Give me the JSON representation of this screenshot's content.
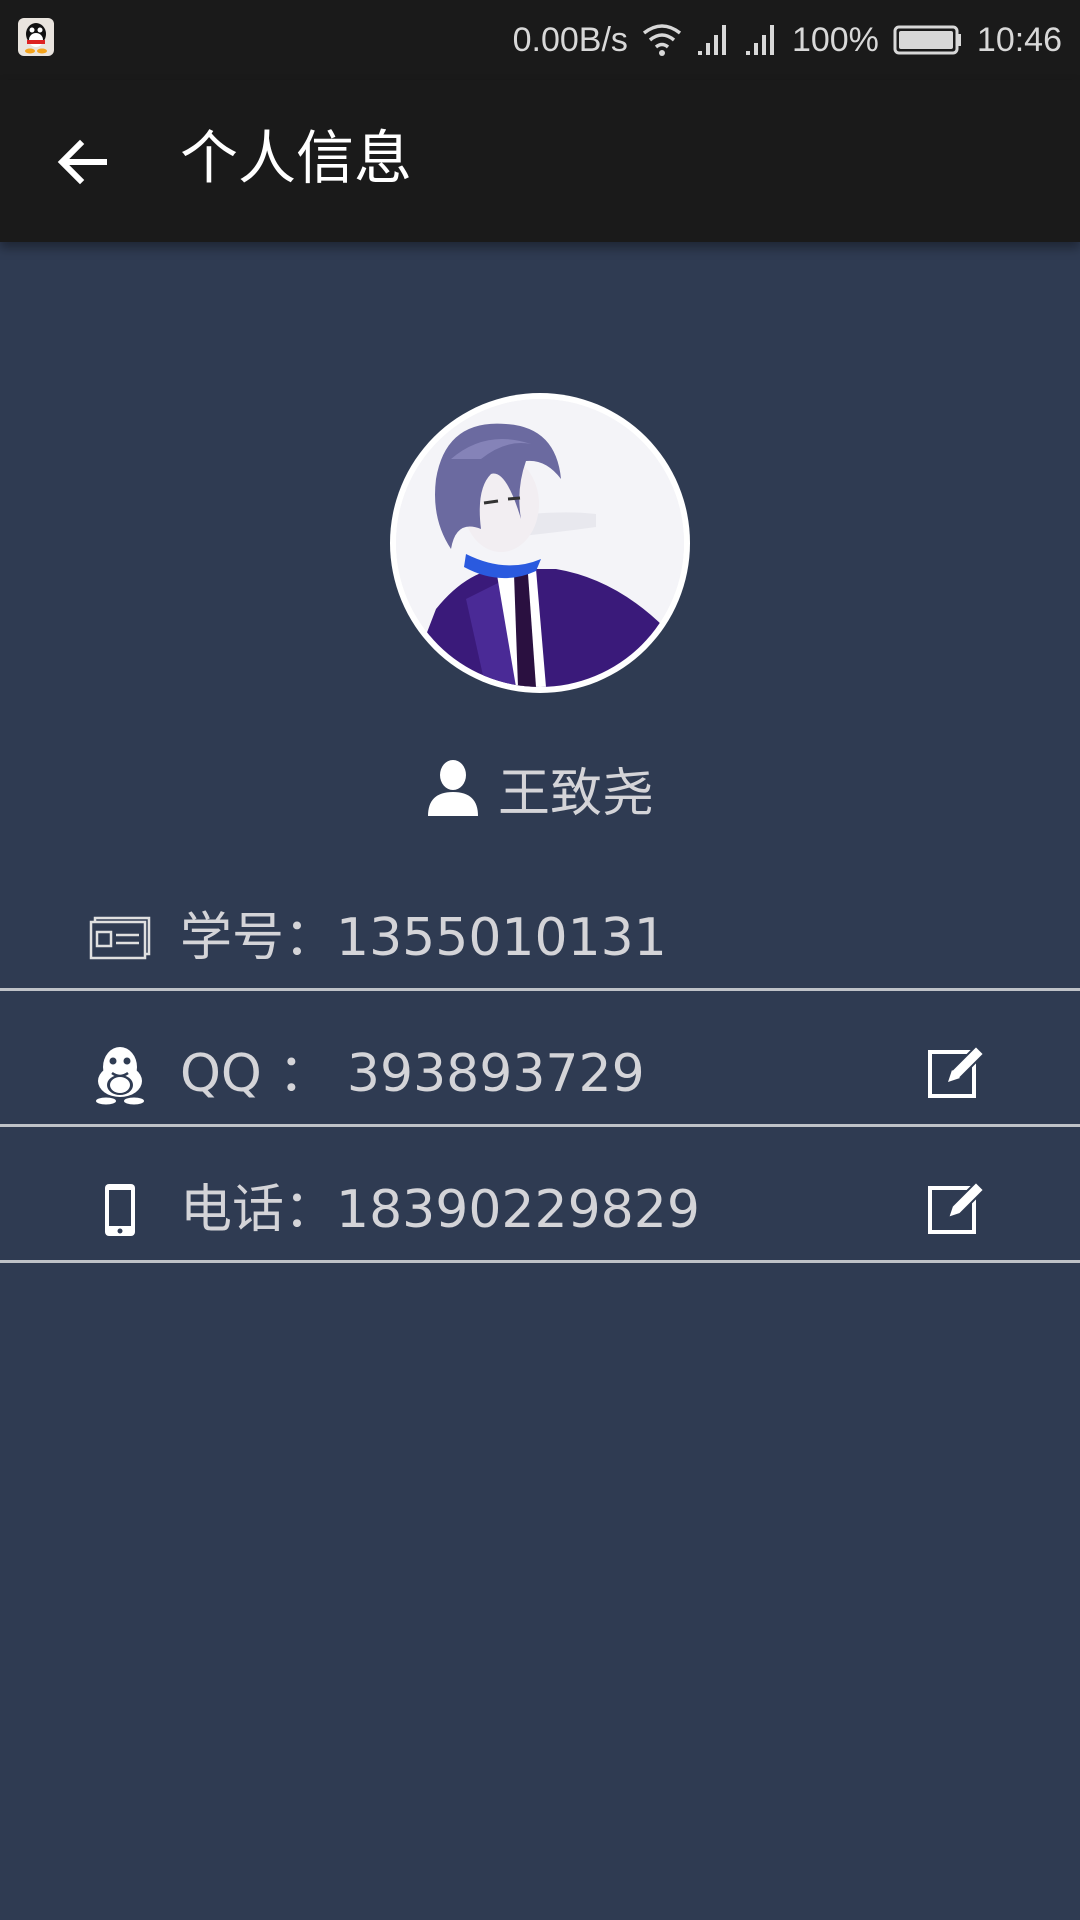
{
  "status_bar": {
    "app_icon": "qq-penguin-icon",
    "net_speed": "0.00B/s",
    "battery": "100%",
    "time": "10:46"
  },
  "app_bar": {
    "back_icon": "arrow-left-icon",
    "title": "个人信息"
  },
  "profile": {
    "avatar": "anime-avatar-image",
    "name_icon": "user-icon",
    "name": "王致尧"
  },
  "info": {
    "student_id": {
      "icon": "id-card-icon",
      "label": "学号：1355010131",
      "editable": false
    },
    "qq": {
      "icon": "qq-penguin-icon",
      "label": "QQ ： 393893729",
      "editable": true
    },
    "phone": {
      "icon": "phone-icon",
      "label": "电话：18390229829",
      "editable": true
    }
  },
  "colors": {
    "background": "#2f3b52",
    "bar": "#1a1a1a",
    "text": "#d4d4d8",
    "divider": "#bfc2c8"
  }
}
